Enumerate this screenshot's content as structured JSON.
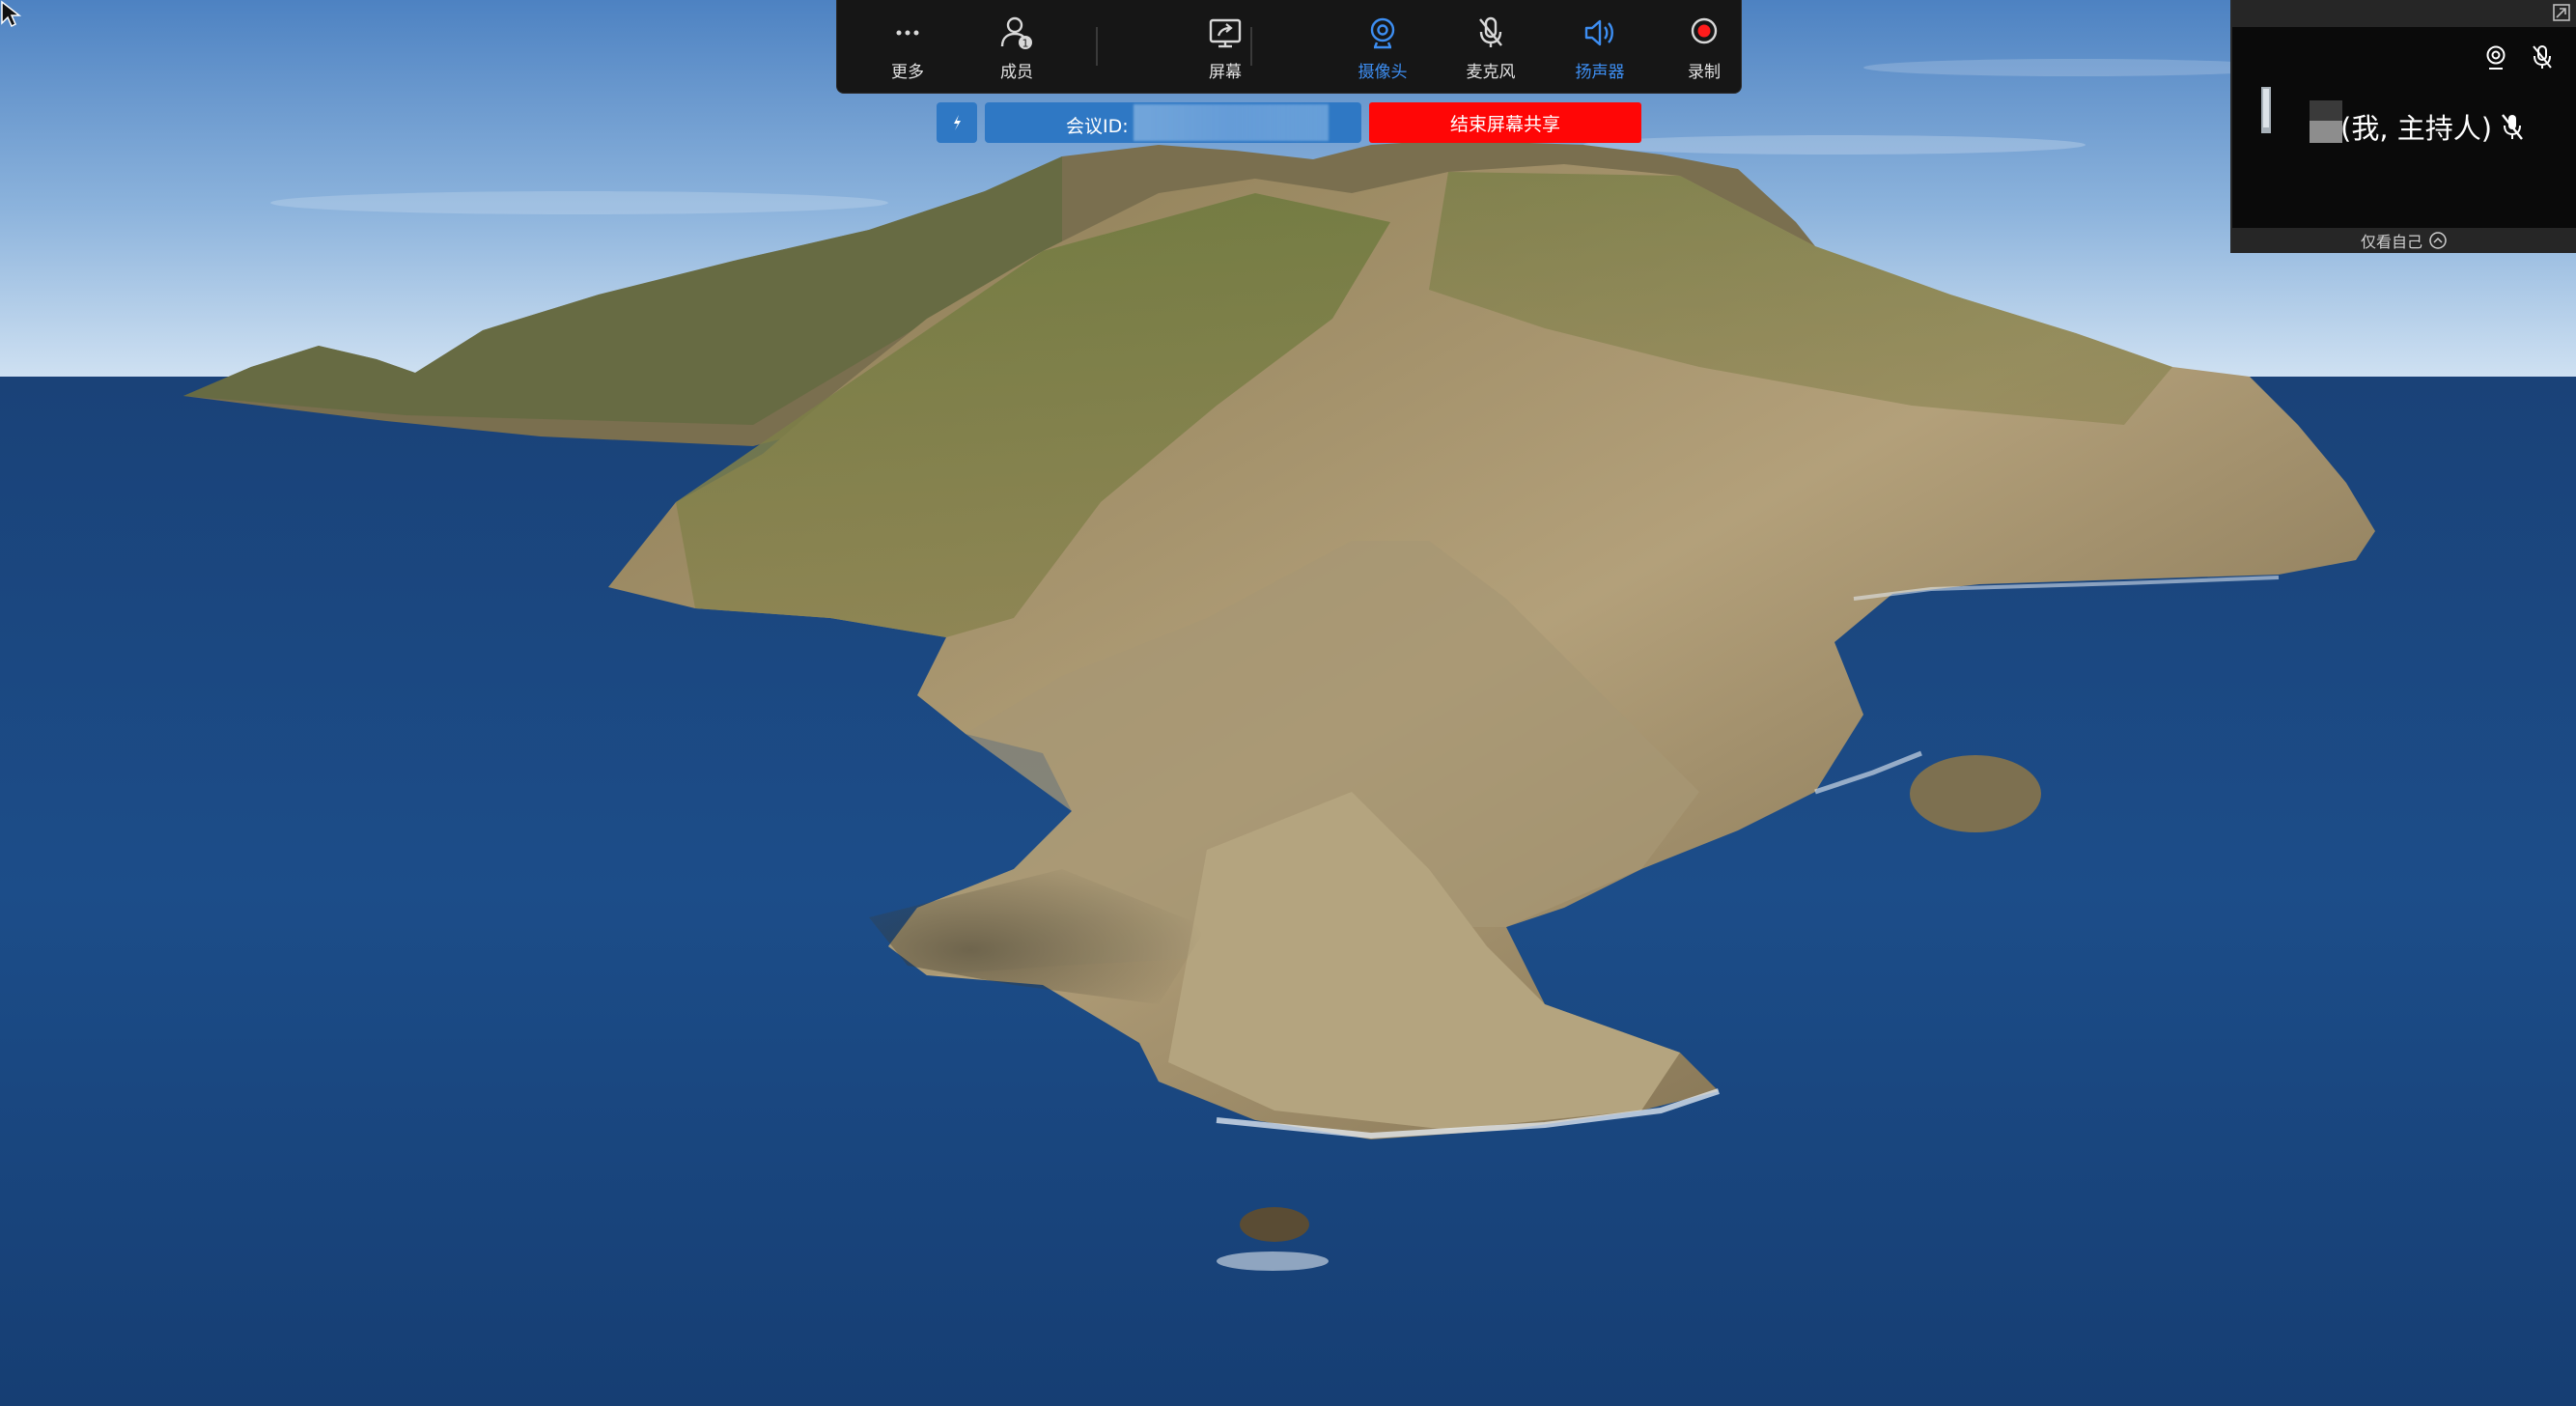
{
  "toolbar": {
    "buttons": [
      {
        "label": "更多",
        "icon": "more-icon"
      },
      {
        "label": "成员",
        "icon": "members-icon",
        "badge": "1"
      },
      {
        "label": "屏幕",
        "icon": "screen-share-icon"
      },
      {
        "label": "摄像头",
        "icon": "camera-icon",
        "active": true
      },
      {
        "label": "麦克风",
        "icon": "mic-muted-icon"
      },
      {
        "label": "扬声器",
        "icon": "speaker-icon",
        "active": true
      },
      {
        "label": "录制",
        "icon": "record-icon"
      }
    ]
  },
  "share_bar": {
    "meeting_id_label": "会议ID:",
    "stop_share_label": "结束屏幕共享"
  },
  "video_panel": {
    "participant_name": "(我, 主持人)",
    "self_view_label": "仅看自己"
  },
  "colors": {
    "accent": "#3d8ef2",
    "share_bar": "#2f78c4",
    "stop_button": "#ff0606",
    "toolbar_bg": "#161616"
  }
}
